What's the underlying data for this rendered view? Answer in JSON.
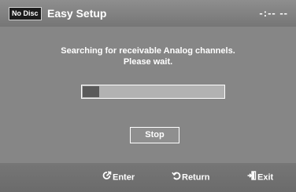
{
  "header": {
    "badge": "No Disc",
    "title": "Easy Setup",
    "clock": "-:-- --"
  },
  "message": {
    "line1": "Searching for receivable Analog channels.",
    "line2": "Please wait."
  },
  "progress": {
    "fraction": 0.12,
    "fill_color": "#5a5a5a",
    "track_color": "#b2b2b2"
  },
  "buttons": {
    "stop": "Stop"
  },
  "footer": {
    "enter": {
      "icon": "enter-icon",
      "label": "Enter"
    },
    "return": {
      "icon": "return-icon",
      "label": "Return"
    },
    "exit": {
      "icon": "exit-icon",
      "label": "Exit"
    }
  }
}
